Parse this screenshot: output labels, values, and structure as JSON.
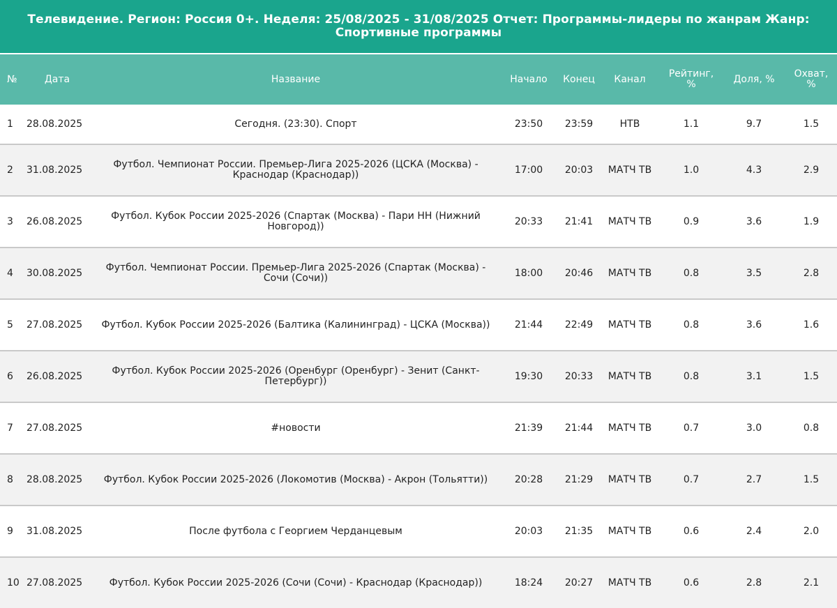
{
  "report": {
    "title": "Телевидение. Регион: Россия 0+. Неделя: 25/08/2025 - 31/08/2025 Отчет: Программы-лидеры по жанрам Жанр: Спортивные программы"
  },
  "table": {
    "columns": {
      "num": "№",
      "date": "Дата",
      "name": "Название",
      "start": "Начало",
      "end": "Конец",
      "channel": "Канал",
      "rating": "Рейтинг, %",
      "share": "Доля, %",
      "reach": "Охват, %"
    },
    "rows": [
      {
        "num": "1",
        "date": "28.08.2025",
        "name": "Сегодня. (23:30). Спорт",
        "start": "23:50",
        "end": "23:59",
        "channel": "НТВ",
        "rating": "1.1",
        "share": "9.7",
        "reach": "1.5"
      },
      {
        "num": "2",
        "date": "31.08.2025",
        "name": "Футбол. Чемпионат России. Премьер-Лига 2025-2026 (ЦСКА (Москва) - Краснодар (Краснодар))",
        "start": "17:00",
        "end": "20:03",
        "channel": "МАТЧ ТВ",
        "rating": "1.0",
        "share": "4.3",
        "reach": "2.9"
      },
      {
        "num": "3",
        "date": "26.08.2025",
        "name": "Футбол. Кубок России 2025-2026 (Спартак (Москва) - Пари НН (Нижний Новгород))",
        "start": "20:33",
        "end": "21:41",
        "channel": "МАТЧ ТВ",
        "rating": "0.9",
        "share": "3.6",
        "reach": "1.9"
      },
      {
        "num": "4",
        "date": "30.08.2025",
        "name": "Футбол. Чемпионат России. Премьер-Лига 2025-2026 (Спартак (Москва) - Сочи (Сочи))",
        "start": "18:00",
        "end": "20:46",
        "channel": "МАТЧ ТВ",
        "rating": "0.8",
        "share": "3.5",
        "reach": "2.8"
      },
      {
        "num": "5",
        "date": "27.08.2025",
        "name": "Футбол. Кубок России 2025-2026 (Балтика (Калининград) - ЦСКА (Москва))",
        "start": "21:44",
        "end": "22:49",
        "channel": "МАТЧ ТВ",
        "rating": "0.8",
        "share": "3.6",
        "reach": "1.6"
      },
      {
        "num": "6",
        "date": "26.08.2025",
        "name": "Футбол. Кубок России 2025-2026 (Оренбург (Оренбург) - Зенит (Санкт-Петербург))",
        "start": "19:30",
        "end": "20:33",
        "channel": "МАТЧ ТВ",
        "rating": "0.8",
        "share": "3.1",
        "reach": "1.5"
      },
      {
        "num": "7",
        "date": "27.08.2025",
        "name": "#новости",
        "start": "21:39",
        "end": "21:44",
        "channel": "МАТЧ ТВ",
        "rating": "0.7",
        "share": "3.0",
        "reach": "0.8"
      },
      {
        "num": "8",
        "date": "28.08.2025",
        "name": "Футбол. Кубок России 2025-2026 (Локомотив (Москва) - Акрон (Тольятти))",
        "start": "20:28",
        "end": "21:29",
        "channel": "МАТЧ ТВ",
        "rating": "0.7",
        "share": "2.7",
        "reach": "1.5"
      },
      {
        "num": "9",
        "date": "31.08.2025",
        "name": "После футбола с Георгием Черданцевым",
        "start": "20:03",
        "end": "21:35",
        "channel": "МАТЧ ТВ",
        "rating": "0.6",
        "share": "2.4",
        "reach": "2.0"
      },
      {
        "num": "10",
        "date": "27.08.2025",
        "name": "Футбол. Кубок России 2025-2026 (Сочи (Сочи) - Краснодар (Краснодар))",
        "start": "18:24",
        "end": "20:27",
        "channel": "МАТЧ ТВ",
        "rating": "0.6",
        "share": "2.8",
        "reach": "2.1"
      }
    ]
  },
  "colors": {
    "title_bg": "#1aa58d",
    "header_bg": "#59b9a9",
    "row_alt_bg": "#f2f2f2",
    "row_border": "#c9c9c9"
  }
}
